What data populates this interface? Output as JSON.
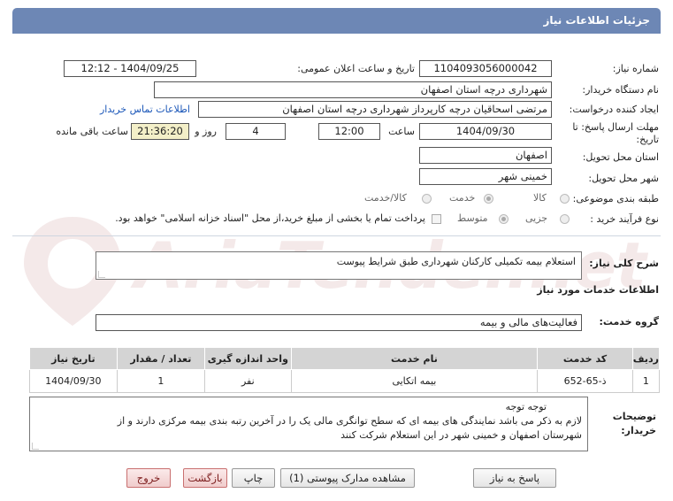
{
  "header": {
    "title": "جزئیات اطلاعات نیاز"
  },
  "fields": {
    "need_number_label": "شماره نیاز:",
    "need_number": "1104093056000042",
    "announce_label": "تاریخ و ساعت اعلان عمومی:",
    "announce_value": "1404/09/25 - 12:12",
    "buyer_org_label": "نام دستگاه خریدار:",
    "buyer_org": "شهرداری درچه استان اصفهان",
    "creator_label": "ایجاد کننده درخواست:",
    "creator": "مرتضی اسحاقیان درچه کارپرداز شهرداری درچه استان اصفهان",
    "contact_link": "اطلاعات تماس خریدار",
    "deadline_label_1": "مهلت ارسال پاسخ: تا",
    "deadline_label_2": "تاریخ:",
    "deadline_date": "1404/09/30",
    "time_label": "ساعت",
    "deadline_time": "12:00",
    "days_value": "4",
    "days_label": "روز و",
    "remaining_time": "21:36:20",
    "remaining_label": "ساعت باقی مانده",
    "province_label": "استان محل تحویل:",
    "province": "اصفهان",
    "city_label": "شهر محل تحویل:",
    "city": "خمینی شهر",
    "category_label": "طبقه بندی موضوعی:",
    "category_options": [
      "کالا",
      "خدمت",
      "کالا/خدمت"
    ],
    "process_label": "نوع فرآیند خرید :",
    "process_options": [
      "جزیی",
      "متوسط"
    ],
    "payment_note": "پرداخت تمام یا بخشی از مبلغ خرید،از محل \"اسناد خزانه اسلامی\" خواهد بود."
  },
  "summary": {
    "label": "شرح کلی نیاز:",
    "value": "استعلام بیمه تکمیلی  کارکنان شهرداری  طبق شرایط پیوست"
  },
  "services": {
    "section_title": "اطلاعات خدمات مورد نیاز",
    "group_label": "گروه خدمت:",
    "group_value": "فعالیت‌های مالی و بیمه",
    "columns": [
      "ردیف",
      "کد خدمت",
      "نام خدمت",
      "واحد اندازه گیری",
      "تعداد / مقدار",
      "تاریخ نیاز"
    ],
    "rows": [
      [
        "1",
        "ذ-65-652",
        "بیمه اتکایی",
        "نفر",
        "1",
        "1404/09/30"
      ]
    ]
  },
  "buyer_notes": {
    "label_1": "توضیحات",
    "label_2": "خریدار:",
    "line1": "توجه  توجه",
    "line2": "لازم به ذکر می باشد نمایندگی های بیمه ای که سطح  توانگری مالی یک  را در آخرین رتبه بندی  بیمه مرکزی  دارند و از",
    "line3": "شهرستان اصفهان و خمینی شهر  در این استعلام شرکت کنند"
  },
  "buttons": {
    "reply": "پاسخ به نیاز",
    "attachments": "مشاهده مدارک پیوستی (1)",
    "print": "چاپ",
    "back": "بازگشت",
    "exit": "خروج"
  },
  "watermark": {
    "text": "AriaTender.net"
  },
  "colors": {
    "header": "#6d87b5",
    "remaining_bg": "#f3efc8",
    "link": "#1a56b8"
  }
}
